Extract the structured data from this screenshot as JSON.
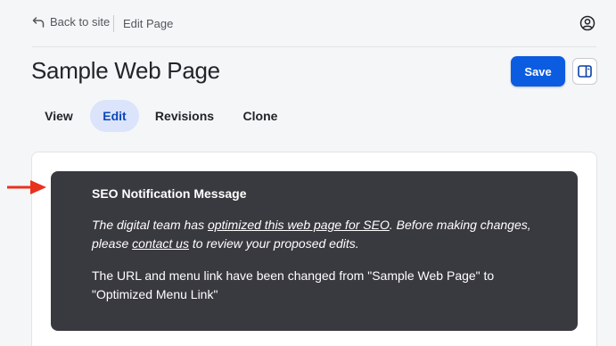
{
  "header": {
    "back_label": "Back to site",
    "breadcrumb_current": "Edit Page"
  },
  "page": {
    "title": "Sample Web Page",
    "save_label": "Save"
  },
  "tabs": [
    {
      "label": "View",
      "active": false
    },
    {
      "label": "Edit",
      "active": true
    },
    {
      "label": "Revisions",
      "active": false
    },
    {
      "label": "Clone",
      "active": false
    }
  ],
  "notice": {
    "title": "SEO Notification Message",
    "p1_part1": "The digital team has ",
    "p1_link1": "optimized this web page for SEO",
    "p1_part2": ". Before making changes, please ",
    "p1_link2": "contact us",
    "p1_part3": " to review your proposed edits.",
    "p2": "The URL and menu link have been changed from \"Sample Web Page\" to \"Optimized Menu Link\""
  },
  "colors": {
    "primary": "#0b5ce0",
    "active_tab_bg": "#dbe4fa",
    "notice_bg": "#393940",
    "arrow": "#e8321e"
  },
  "icons": {
    "back": "return-arrow-icon",
    "user": "user-circle-icon",
    "panel": "sidebar-toggle-icon",
    "pointer": "red-arrow-icon"
  }
}
